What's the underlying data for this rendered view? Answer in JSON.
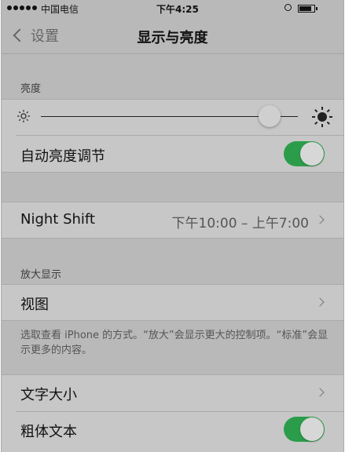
{
  "status_bar": {
    "carrier": "中国电信",
    "time": "下午4:25"
  },
  "nav": {
    "back_label": "设置",
    "title": "显示与亮度"
  },
  "brightness": {
    "header": "亮度",
    "slider_value": 0.89
  },
  "auto_brightness": {
    "label": "自动亮度调节",
    "on": true
  },
  "night_shift": {
    "label": "Night Shift",
    "detail": "下午10:00 – 上午7:00"
  },
  "zoom": {
    "header": "放大显示",
    "view_label": "视图",
    "footer": "选取查看 iPhone 的方式。“放大”会显示更大的控制项。“标准”会显示更多的内容。"
  },
  "text": {
    "size_label": "文字大小",
    "bold_label": "粗体文本",
    "bold_on": true
  },
  "colors": {
    "toggle_on": "#2b9d4a"
  },
  "icons": {
    "back": "chevron-left-icon",
    "sun_small": "sun-small-icon",
    "sun_large": "sun-large-icon",
    "disclosure": "chevron-right-icon"
  }
}
